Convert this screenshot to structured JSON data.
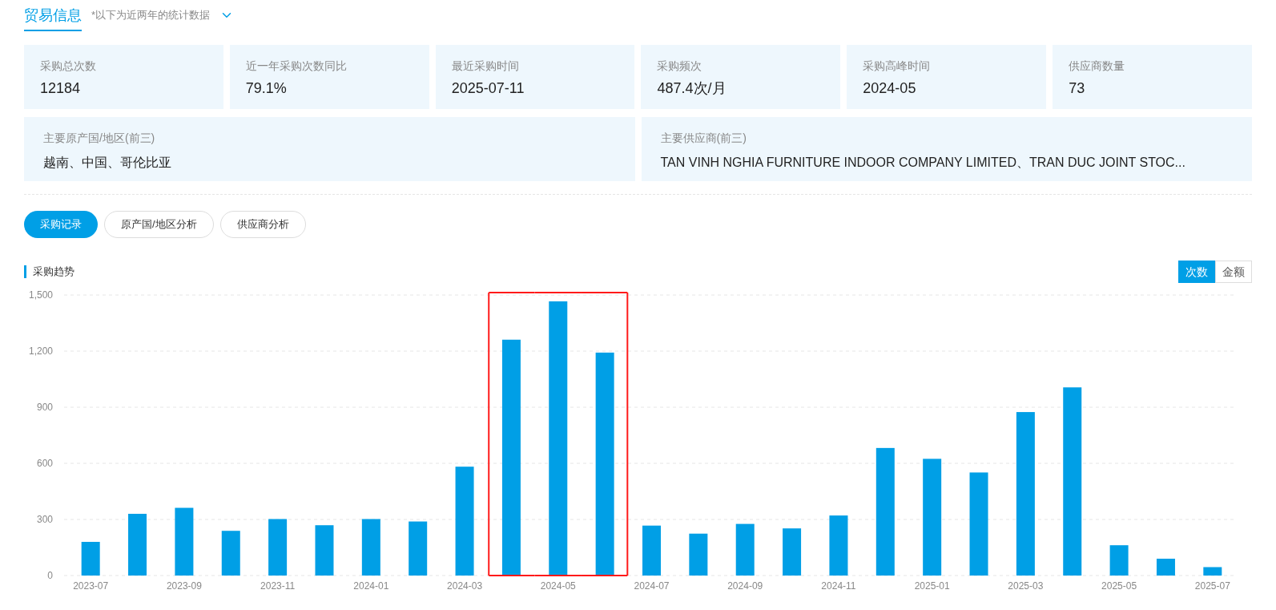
{
  "header": {
    "title": "贸易信息",
    "note": "*以下为近两年的统计数据"
  },
  "stats": [
    {
      "label": "采购总次数",
      "value": "12184"
    },
    {
      "label": "近一年采购次数同比",
      "value": "79.1%"
    },
    {
      "label": "最近采购时间",
      "value": "2025-07-11"
    },
    {
      "label": "采购频次",
      "value": "487.4次/月"
    },
    {
      "label": "采购高峰时间",
      "value": "2024-05"
    },
    {
      "label": "供应商数量",
      "value": "73"
    }
  ],
  "top_three": [
    {
      "label": "主要原产国/地区(前三)",
      "value": "越南、中国、哥伦比亚"
    },
    {
      "label": "主要供应商(前三)",
      "value": "TAN VINH NGHIA FURNITURE INDOOR COMPANY LIMITED、TRAN DUC JOINT STOC..."
    }
  ],
  "tabs": [
    {
      "label": "采购记录",
      "selected": true
    },
    {
      "label": "原产国/地区分析",
      "selected": false
    },
    {
      "label": "供应商分析",
      "selected": false
    }
  ],
  "trend": {
    "title": "采购趋势",
    "toggle": [
      {
        "label": "次数",
        "selected": true
      },
      {
        "label": "金额",
        "selected": false
      }
    ],
    "bars": [
      {
        "framed": false
      },
      {
        "framed": false
      },
      {
        "framed": false
      },
      {
        "framed": false
      },
      {
        "framed": false
      },
      {
        "framed": false
      },
      {
        "framed": false
      },
      {
        "framed": false
      },
      {
        "framed": false
      },
      {
        "framed": true
      },
      {
        "framed": true
      },
      {
        "framed": true
      },
      {
        "framed": false
      },
      {
        "framed": false
      },
      {
        "framed": false
      },
      {
        "framed": false
      },
      {
        "framed": false
      },
      {
        "framed": false
      },
      {
        "framed": false
      },
      {
        "framed": false
      },
      {
        "framed": false
      },
      {
        "framed": false
      },
      {
        "framed": false
      },
      {
        "framed": false
      },
      {
        "framed": false
      }
    ],
    "chart_data": {
      "type": "bar",
      "categories": [
        "2023-07",
        null,
        "2023-09",
        null,
        "2023-11",
        null,
        "2024-01",
        null,
        "2024-03",
        null,
        "2024-05",
        null,
        "2024-07",
        null,
        "2024-09",
        null,
        "2024-11",
        null,
        "2025-01",
        null,
        "2025-03",
        null,
        "2025-05",
        null,
        "2025-07"
      ],
      "grid": true,
      "series": [
        {
          "color": "#009fe6",
          "values": [
            180,
            330,
            362,
            239,
            302,
            269,
            302,
            289,
            582,
            1261,
            1466,
            1192,
            267,
            224,
            276,
            252,
            321,
            682,
            624,
            551,
            874,
            1006,
            162,
            90,
            45
          ]
        }
      ],
      "ylim": [
        0,
        1500
      ],
      "yticks": [
        {
          "value": 0,
          "label": "0"
        },
        {
          "value": 300,
          "label": "300"
        },
        {
          "value": 600,
          "label": "600"
        },
        {
          "value": 900,
          "label": "900"
        },
        {
          "value": 1200,
          "label": "1,200"
        },
        {
          "value": 1500,
          "label": "1,500"
        }
      ]
    }
  }
}
